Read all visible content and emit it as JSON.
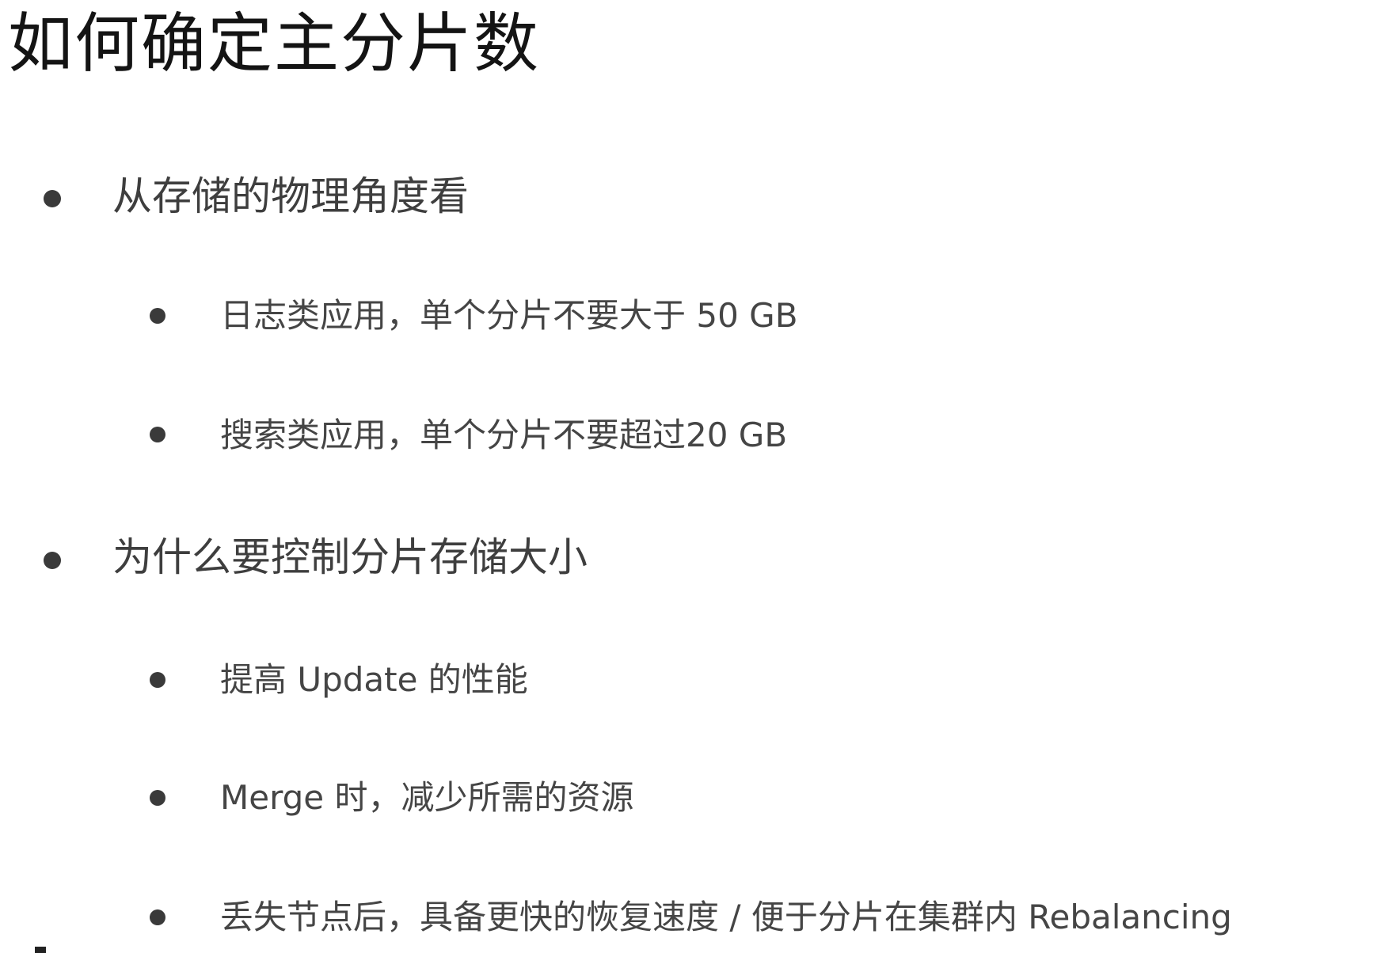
{
  "slide": {
    "title": "如何确定主分片数",
    "bullets": [
      {
        "level": 1,
        "text": "从存储的物理角度看"
      },
      {
        "level": 2,
        "text": "日志类应用，单个分片不要大于 50 GB"
      },
      {
        "level": 2,
        "text": "搜索类应用，单个分片不要超过20 GB"
      },
      {
        "level": 1,
        "text": "为什么要控制分片存储大小"
      },
      {
        "level": 2,
        "text": "提高 Update 的性能"
      },
      {
        "level": 2,
        "text": "Merge 时，减少所需的资源"
      },
      {
        "level": 2,
        "text": "丢失节点后，具备更快的恢复速度 / 便于分片在集群内 Rebalancing"
      }
    ]
  }
}
